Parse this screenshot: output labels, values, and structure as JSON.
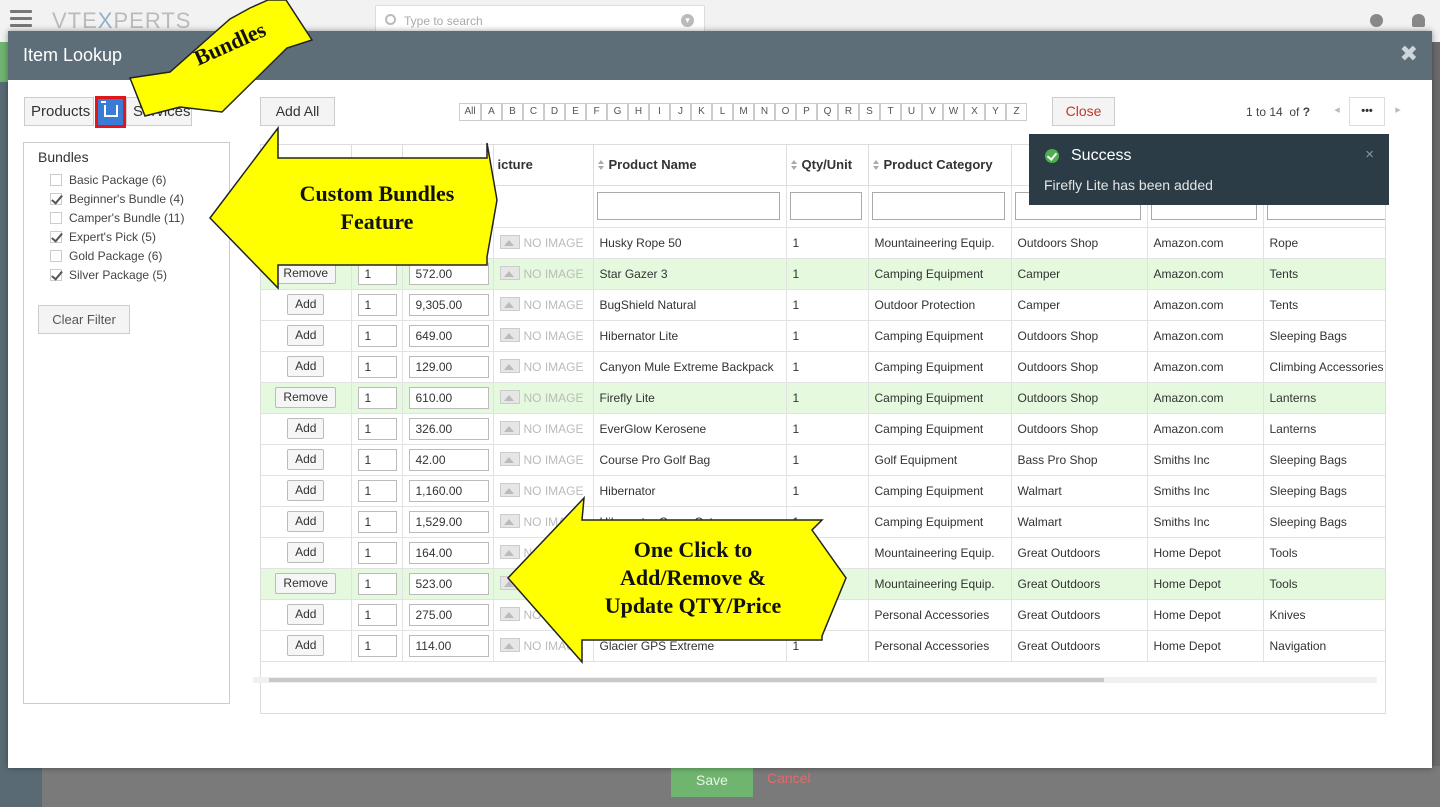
{
  "app": {
    "logo_left": "VTE",
    "logo_x": "X",
    "logo_right": "PERTS",
    "search_placeholder": "Type to search",
    "save_label": "Save",
    "cancel_label": "Cancel"
  },
  "modal": {
    "title": "Item Lookup",
    "close_icon": "close-icon"
  },
  "tabs": {
    "products": "Products",
    "services": "Services",
    "bundles_icon": "cart-icon"
  },
  "filter": {
    "title": "Bundles",
    "items": [
      {
        "label": "Basic Package (6)",
        "checked": false
      },
      {
        "label": "Beginner's Bundle (4)",
        "checked": true
      },
      {
        "label": "Camper's Bundle (11)",
        "checked": false
      },
      {
        "label": "Expert's Pick (5)",
        "checked": true
      },
      {
        "label": "Gold Package (6)",
        "checked": false
      },
      {
        "label": "Silver Package (5)",
        "checked": true
      }
    ],
    "clear_label": "Clear Filter"
  },
  "toolbar": {
    "add_all": "Add All",
    "letters": [
      "All",
      "A",
      "B",
      "C",
      "D",
      "E",
      "F",
      "G",
      "H",
      "I",
      "J",
      "K",
      "L",
      "M",
      "N",
      "O",
      "P",
      "Q",
      "R",
      "S",
      "T",
      "U",
      "V",
      "W",
      "X",
      "Y",
      "Z"
    ],
    "close_label": "Close",
    "pager_text": "1 to 14",
    "pager_of": "of",
    "pager_total": "?",
    "pager_more": "•••"
  },
  "table": {
    "headers": [
      "",
      "",
      "",
      "Picture",
      "Product Name",
      "Qty/Unit",
      "Product Category",
      "",
      "",
      ""
    ],
    "picture_header_visible": "icture",
    "no_image": "NO IMAGE",
    "rows": [
      {
        "action": "",
        "qty": "",
        "price": "",
        "name": "Husky Rope 50",
        "unit": "1",
        "category": "Mountaineering Equip.",
        "vendor": "Outdoors Shop",
        "source": "Amazon.com",
        "subcat": "Rope",
        "selected": false
      },
      {
        "action": "Remove",
        "qty": "1",
        "price": "572.00",
        "name": "Star Gazer 3",
        "unit": "1",
        "category": "Camping Equipment",
        "vendor": "Camper",
        "source": "Amazon.com",
        "subcat": "Tents",
        "selected": true
      },
      {
        "action": "Add",
        "qty": "1",
        "price": "9,305.00",
        "name": "BugShield Natural",
        "unit": "1",
        "category": "Outdoor Protection",
        "vendor": "Camper",
        "source": "Amazon.com",
        "subcat": "Tents",
        "selected": false
      },
      {
        "action": "Add",
        "qty": "1",
        "price": "649.00",
        "name": "Hibernator Lite",
        "unit": "1",
        "category": "Camping Equipment",
        "vendor": "Outdoors Shop",
        "source": "Amazon.com",
        "subcat": "Sleeping Bags",
        "selected": false
      },
      {
        "action": "Add",
        "qty": "1",
        "price": "129.00",
        "name": "Canyon Mule Extreme Backpack",
        "unit": "1",
        "category": "Camping Equipment",
        "vendor": "Outdoors Shop",
        "source": "Amazon.com",
        "subcat": "Climbing Accessories",
        "selected": false
      },
      {
        "action": "Remove",
        "qty": "1",
        "price": "610.00",
        "name": "Firefly Lite",
        "unit": "1",
        "category": "Camping Equipment",
        "vendor": "Outdoors Shop",
        "source": "Amazon.com",
        "subcat": "Lanterns",
        "selected": true
      },
      {
        "action": "Add",
        "qty": "1",
        "price": "326.00",
        "name": "EverGlow Kerosene",
        "unit": "1",
        "category": "Camping Equipment",
        "vendor": "Outdoors Shop",
        "source": "Amazon.com",
        "subcat": "Lanterns",
        "selected": false
      },
      {
        "action": "Add",
        "qty": "1",
        "price": "42.00",
        "name": "Course Pro Golf Bag",
        "unit": "1",
        "category": "Golf Equipment",
        "vendor": "Bass Pro Shop",
        "source": "Smiths Inc",
        "subcat": "Sleeping Bags",
        "selected": false
      },
      {
        "action": "Add",
        "qty": "1",
        "price": "1,160.00",
        "name": "Hibernator",
        "unit": "1",
        "category": "Camping Equipment",
        "vendor": "Walmart",
        "source": "Smiths Inc",
        "subcat": "Sleeping Bags",
        "selected": false
      },
      {
        "action": "Add",
        "qty": "1",
        "price": "1,529.00",
        "name": "Hibernator Camp Cot",
        "unit": "1",
        "category": "Camping Equipment",
        "vendor": "Walmart",
        "source": "Smiths Inc",
        "subcat": "Sleeping Bags",
        "selected": false
      },
      {
        "action": "Add",
        "qty": "1",
        "price": "164.00",
        "name": "",
        "unit": "",
        "category": "Mountaineering Equip.",
        "vendor": "Great Outdoors",
        "source": "Home Depot",
        "subcat": "Tools",
        "selected": false
      },
      {
        "action": "Remove",
        "qty": "1",
        "price": "523.00",
        "name": "",
        "unit": "",
        "category": "Mountaineering Equip.",
        "vendor": "Great Outdoors",
        "source": "Home Depot",
        "subcat": "Tools",
        "selected": true
      },
      {
        "action": "Add",
        "qty": "1",
        "price": "275.00",
        "name": "",
        "unit": "",
        "category": "Personal Accessories",
        "vendor": "Great Outdoors",
        "source": "Home Depot",
        "subcat": "Knives",
        "selected": false
      },
      {
        "action": "Add",
        "qty": "1",
        "price": "114.00",
        "name": "Glacier GPS Extreme",
        "unit": "1",
        "category": "Personal Accessories",
        "vendor": "Great Outdoors",
        "source": "Home Depot",
        "subcat": "Navigation",
        "selected": false
      }
    ]
  },
  "toast": {
    "title": "Success",
    "message": "Firefly Lite has been added",
    "close": "×"
  },
  "annotations": {
    "bundles": "Bundles",
    "custom_line1": "Custom Bundles",
    "custom_line2": "Feature",
    "click_line1": "One Click to",
    "click_line2": "Add/Remove &",
    "click_line3": "Update QTY/Price",
    "arrow_color": "#ffff00"
  },
  "colors": {
    "header_bg": "#5e6e79",
    "selected_row": "#e4f9de",
    "toast_bg": "#2b3c47",
    "accent_red": "#e0161b",
    "bundle_blue": "#3a7bd5"
  }
}
